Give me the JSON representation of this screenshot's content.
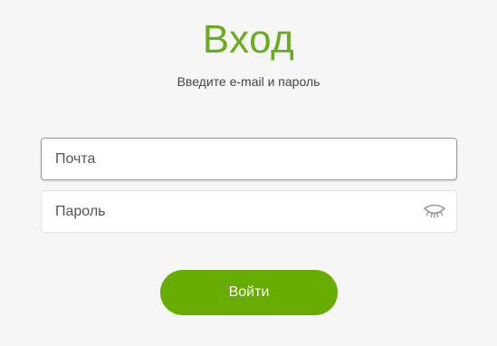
{
  "login": {
    "title": "Вход",
    "subtitle": "Введите e-mail и пароль",
    "email": {
      "placeholder": "Почта",
      "value": ""
    },
    "password": {
      "placeholder": "Пароль",
      "value": "",
      "toggle_icon": "eye-closed-icon"
    },
    "submit_label": "Войти"
  },
  "colors": {
    "accent": "#67ad00",
    "title": "#67ad1e",
    "background": "#f6f6f6"
  }
}
